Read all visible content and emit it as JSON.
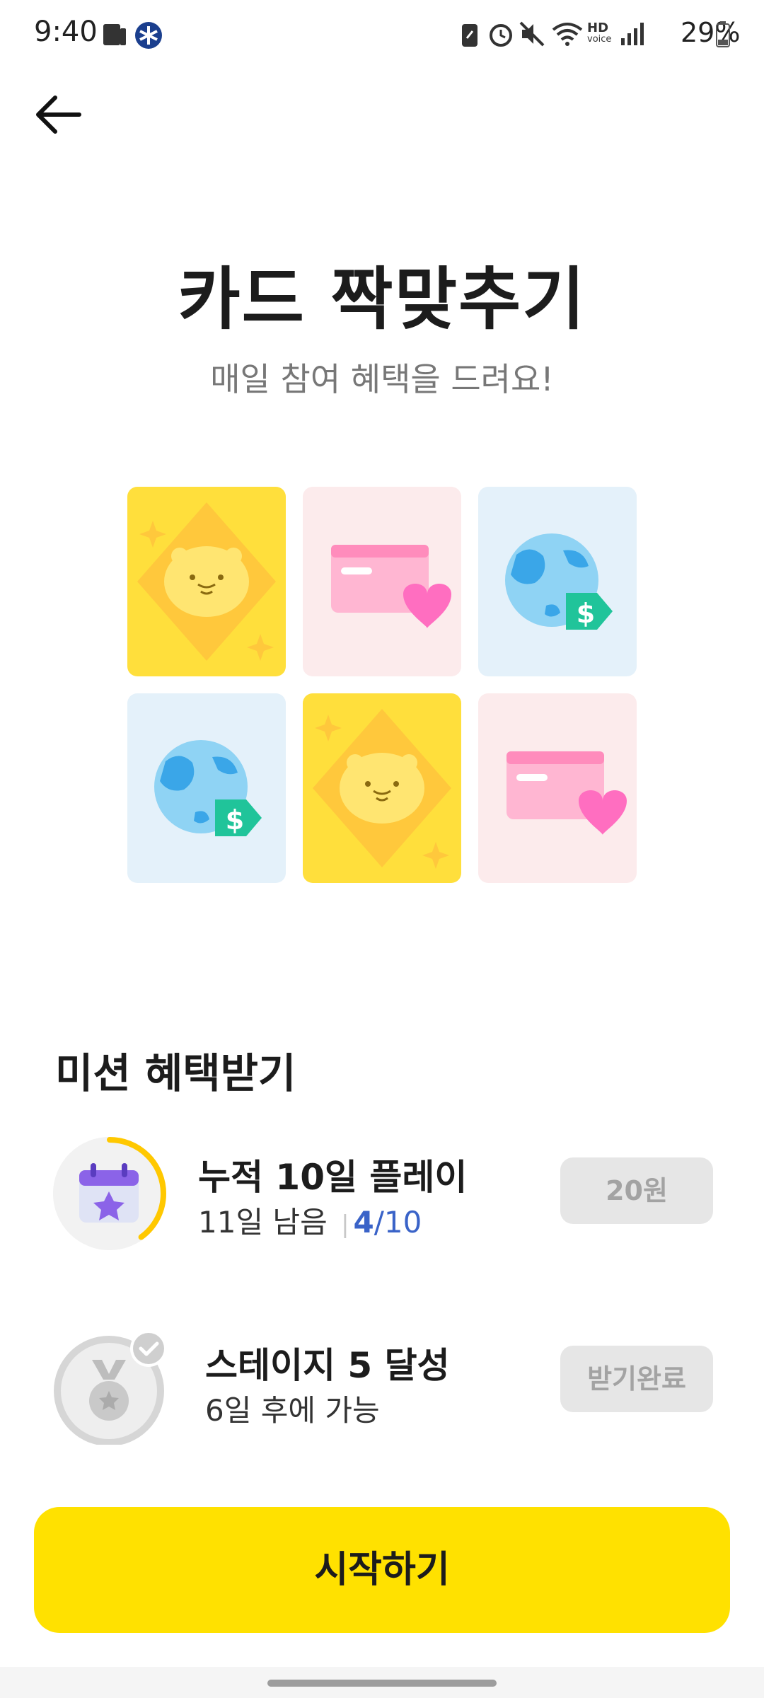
{
  "status_bar": {
    "time": "9:40",
    "battery_percent": "29%",
    "hd_label": "HD",
    "voice_label": "voice"
  },
  "header": {
    "back_icon": "arrow-left-icon"
  },
  "hero": {
    "title": "카드 짝맞추기",
    "subtitle": "매일 참여 혜택을 드려요!"
  },
  "cards": [
    {
      "kind": "lion",
      "color": "yellow"
    },
    {
      "kind": "credit-card-heart",
      "color": "pink"
    },
    {
      "kind": "globe-dollar",
      "color": "blue"
    },
    {
      "kind": "globe-dollar",
      "color": "blue"
    },
    {
      "kind": "lion",
      "color": "yellow"
    },
    {
      "kind": "credit-card-heart",
      "color": "pink"
    }
  ],
  "missions": {
    "heading": "미션 혜택받기",
    "items": [
      {
        "title": "누적 10일 플레이",
        "remaining": "11일 남음",
        "progress_current": "4",
        "progress_total": "/10",
        "progress_fraction": 0.4,
        "reward_label": "20원",
        "icon": "calendar-star-icon"
      },
      {
        "title": "스테이지 5 달성",
        "subtitle": "6일 후에 가능",
        "reward_label": "받기완료",
        "icon": "medal-check-icon"
      }
    ]
  },
  "colors": {
    "accent_yellow": "#ffe100",
    "progress_blue": "#3a63c8",
    "progress_ring": "#ffc800"
  },
  "start_button": {
    "label": "시작하기"
  }
}
